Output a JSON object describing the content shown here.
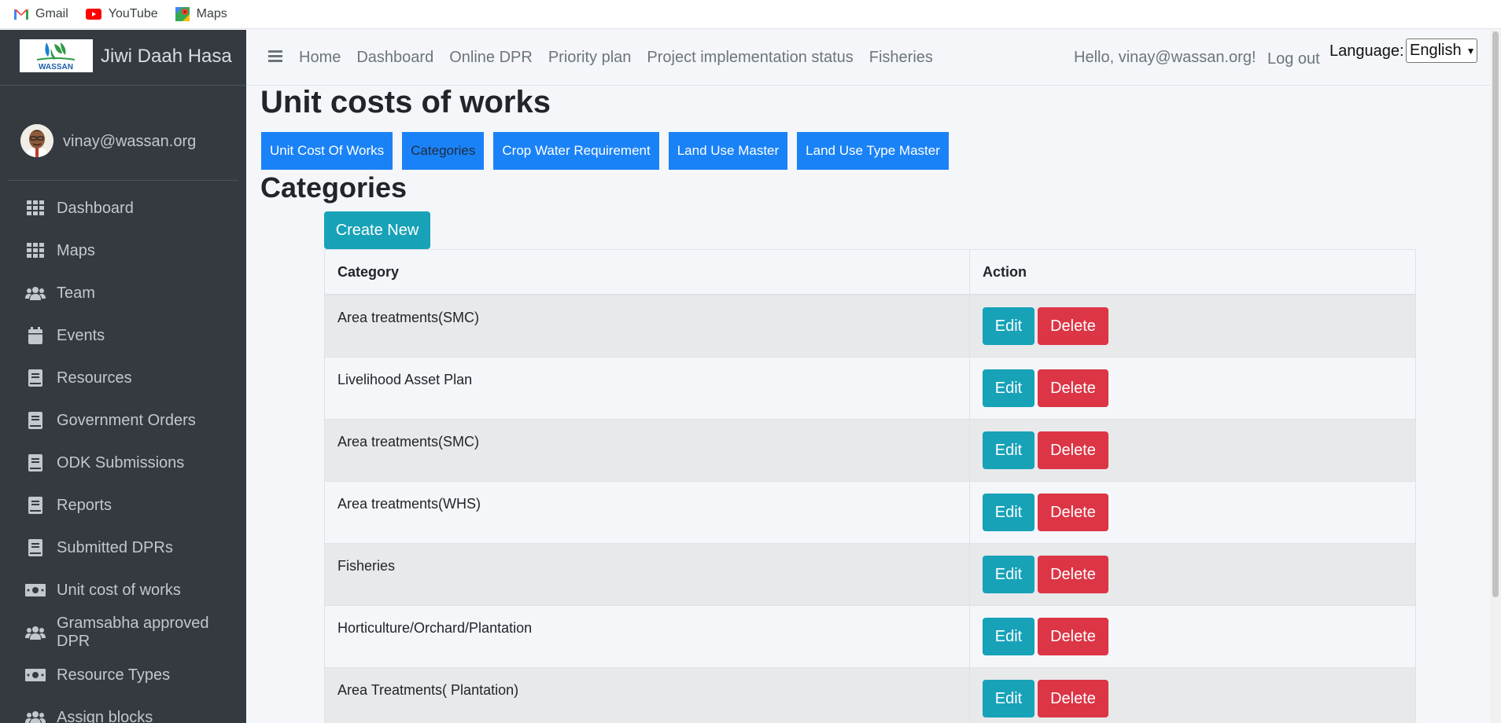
{
  "bookmarks": [
    {
      "label": "Gmail",
      "icon": "gmail-icon"
    },
    {
      "label": "YouTube",
      "icon": "youtube-icon"
    },
    {
      "label": "Maps",
      "icon": "maps-icon"
    }
  ],
  "sidebar": {
    "brand": {
      "logo_text": "WASSAN",
      "name": "Jiwi Daah Hasa"
    },
    "user": "vinay@wassan.org",
    "items": [
      {
        "label": "Dashboard",
        "icon": "grid-icon"
      },
      {
        "label": "Maps",
        "icon": "grid-icon"
      },
      {
        "label": "Team",
        "icon": "users-icon"
      },
      {
        "label": "Events",
        "icon": "calendar-icon"
      },
      {
        "label": "Resources",
        "icon": "book-icon"
      },
      {
        "label": "Government Orders",
        "icon": "book-icon"
      },
      {
        "label": "ODK Submissions",
        "icon": "book-icon"
      },
      {
        "label": "Reports",
        "icon": "book-icon"
      },
      {
        "label": "Submitted DPRs",
        "icon": "book-icon"
      },
      {
        "label": "Unit cost of works",
        "icon": "money-icon"
      },
      {
        "label": "Gramsabha approved DPR",
        "icon": "users-icon"
      },
      {
        "label": "Resource Types",
        "icon": "money-icon"
      },
      {
        "label": "Assign blocks",
        "icon": "users-icon"
      }
    ]
  },
  "topnav": {
    "links": [
      "Home",
      "Dashboard",
      "Online DPR",
      "Priority plan",
      "Project implementation status",
      "Fisheries"
    ],
    "hello": "Hello, vinay@wassan.org!",
    "logout": "Log out",
    "language_label": "Language:",
    "language_value": "English"
  },
  "main": {
    "title": "Unit costs of works",
    "tabs": [
      {
        "label": "Unit Cost Of Works",
        "active": false
      },
      {
        "label": "Categories",
        "active": true
      },
      {
        "label": "Crop Water Requirement",
        "active": false
      },
      {
        "label": "Land Use Master",
        "active": false
      },
      {
        "label": "Land Use Type Master",
        "active": false
      }
    ],
    "section_title": "Categories",
    "create_label": "Create New",
    "table": {
      "headers": [
        "Category",
        "Action"
      ],
      "rows": [
        "Area treatments(SMC)",
        "Livelihood Asset Plan",
        "Area treatments(SMC)",
        "Area treatments(WHS)",
        "Fisheries",
        "Horticulture/Orchard/Plantation",
        "Area Treatments( Plantation)"
      ],
      "edit_label": "Edit",
      "delete_label": "Delete"
    }
  },
  "colors": {
    "sidebar_bg": "#343a40",
    "primary": "#1a82f7",
    "info": "#17a2b8",
    "danger": "#dc3545"
  }
}
